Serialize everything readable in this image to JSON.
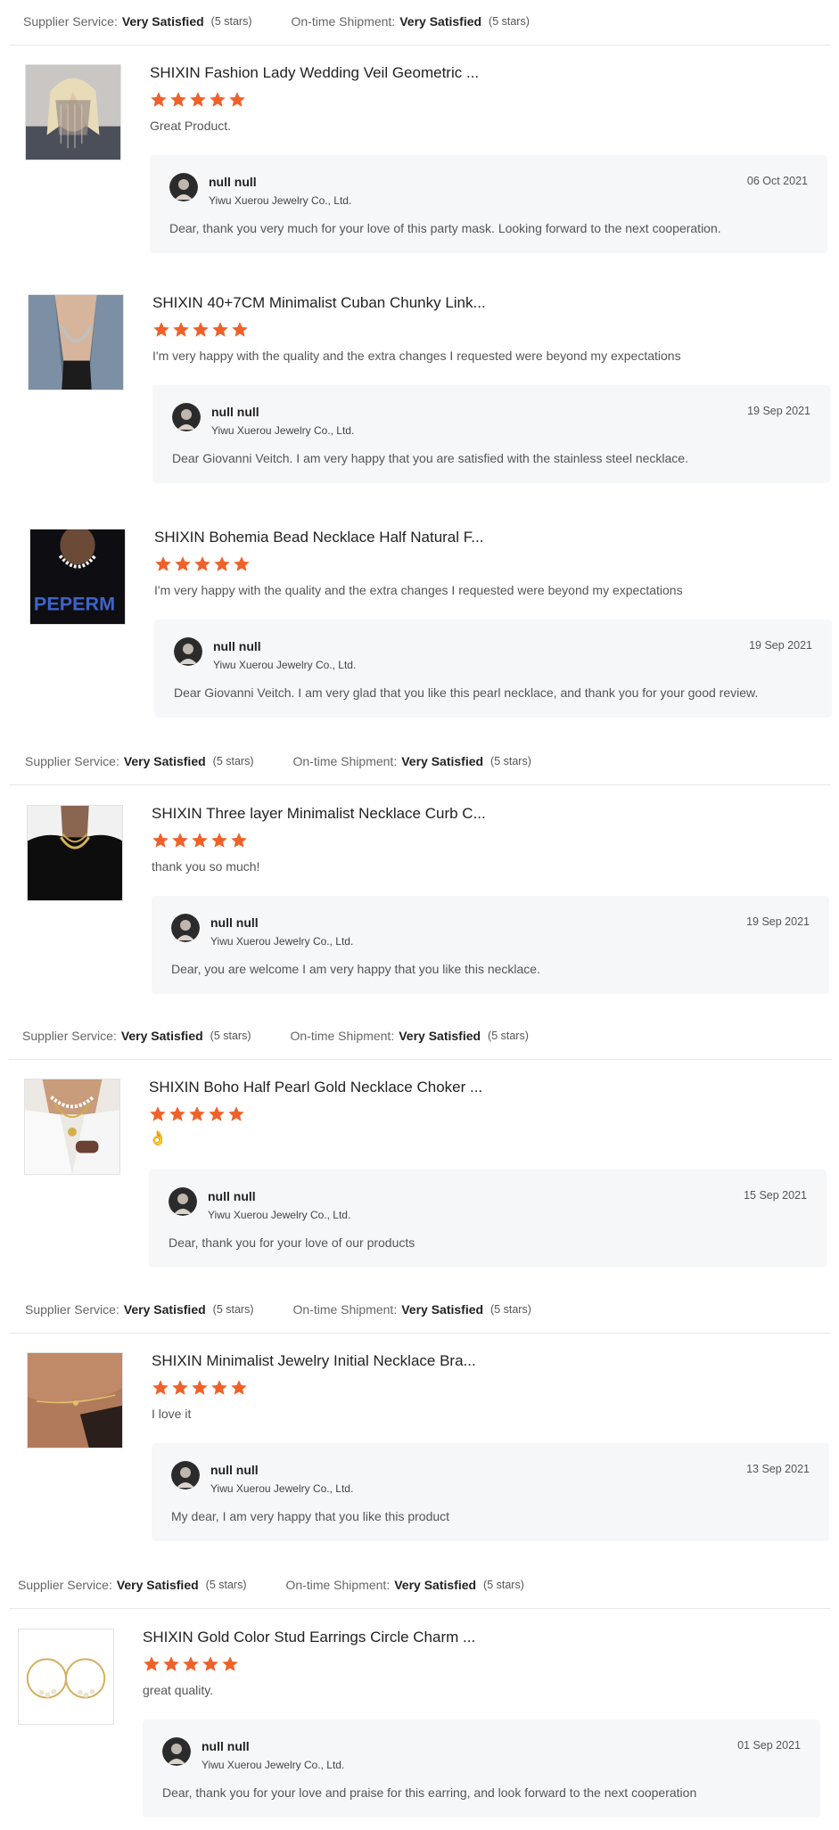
{
  "colors": {
    "star": "#f0612a",
    "reply_bg": "#f6f7f9",
    "divider": "#e8e8e8"
  },
  "summaries": [
    {
      "supplier_label": "Supplier Service:",
      "supplier_value": "Very Satisfied",
      "supplier_count": "(5 stars)",
      "shipment_label": "On-time Shipment:",
      "shipment_value": "Very Satisfied",
      "shipment_count": "(5 stars)"
    },
    {
      "supplier_label": "Supplier Service:",
      "supplier_value": "Very Satisfied",
      "supplier_count": "(5 stars)",
      "shipment_label": "On-time Shipment:",
      "shipment_value": "Very Satisfied",
      "shipment_count": "(5 stars)"
    },
    {
      "supplier_label": "Supplier Service:",
      "supplier_value": "Very Satisfied",
      "supplier_count": "(5 stars)",
      "shipment_label": "On-time Shipment:",
      "shipment_value": "Very Satisfied",
      "shipment_count": "(5 stars)"
    },
    {
      "supplier_label": "Supplier Service:",
      "supplier_value": "Very Satisfied",
      "supplier_count": "(5 stars)",
      "shipment_label": "On-time Shipment:",
      "shipment_value": "Very Satisfied",
      "shipment_count": "(5 stars)"
    },
    {
      "supplier_label": "Supplier Service:",
      "supplier_value": "Very Satisfied",
      "supplier_count": "(5 stars)",
      "shipment_label": "On-time Shipment:",
      "shipment_value": "Very Satisfied",
      "shipment_count": "(5 stars)"
    }
  ],
  "reviews": [
    {
      "title": "SHIXIN Fashion Lady Wedding Veil Geometric ...",
      "rating": 5,
      "comment": "Great Product.",
      "image": "veil-mask-photo",
      "reply": {
        "name": "null null",
        "company": "Yiwu Xuerou Jewelry Co., Ltd.",
        "date": "06 Oct 2021",
        "text": "Dear, thank you very much for your love of this party mask. Looking forward to the next cooperation."
      }
    },
    {
      "title": "SHIXIN 40+7CM Minimalist Cuban Chunky Link...",
      "rating": 5,
      "comment": "I'm very happy with the quality and the extra changes I requested were beyond my expectations",
      "image": "cuban-necklace-photo",
      "reply": {
        "name": "null null",
        "company": "Yiwu Xuerou Jewelry Co., Ltd.",
        "date": "19 Sep 2021",
        "text": "Dear Giovanni Veitch. I am very happy that you are satisfied with the stainless steel necklace."
      }
    },
    {
      "title": "SHIXIN Bohemia Bead Necklace Half Natural F...",
      "rating": 5,
      "comment": "I'm very happy with the quality and the extra changes I requested were beyond my expectations",
      "image": "bead-necklace-photo",
      "reply": {
        "name": "null null",
        "company": "Yiwu Xuerou Jewelry Co., Ltd.",
        "date": "19 Sep 2021",
        "text": "Dear Giovanni Veitch. I am very glad that you like this pearl necklace, and thank you for your good review."
      }
    },
    {
      "title": "SHIXIN Three layer Minimalist Necklace Curb C...",
      "rating": 5,
      "comment": "thank you so much!",
      "image": "layered-necklace-photo",
      "reply": {
        "name": "null null",
        "company": "Yiwu Xuerou Jewelry Co., Ltd.",
        "date": "19 Sep 2021",
        "text": "Dear, you are welcome I am very happy that you like this necklace."
      }
    },
    {
      "title": "SHIXIN Boho Half Pearl Gold Necklace Choker ...",
      "rating": 5,
      "comment": "👌",
      "image": "pearl-choker-photo",
      "reply": {
        "name": "null null",
        "company": "Yiwu Xuerou Jewelry Co., Ltd.",
        "date": "15 Sep 2021",
        "text": "Dear, thank you for your love of our products"
      }
    },
    {
      "title": "SHIXIN Minimalist Jewelry Initial Necklace Bra...",
      "rating": 5,
      "comment": "I love it",
      "image": "bracelet-photo",
      "reply": {
        "name": "null null",
        "company": "Yiwu Xuerou Jewelry Co., Ltd.",
        "date": "13 Sep 2021",
        "text": "My dear, I am very happy that you like this product"
      }
    },
    {
      "title": "SHIXIN Gold Color Stud Earrings Circle Charm ...",
      "rating": 5,
      "comment": "great quality.",
      "image": "earrings-photo",
      "reply": {
        "name": "null null",
        "company": "Yiwu Xuerou Jewelry Co., Ltd.",
        "date": "01 Sep 2021",
        "text": "Dear, thank you for your love and praise for this earring, and look forward to the next cooperation"
      }
    }
  ]
}
